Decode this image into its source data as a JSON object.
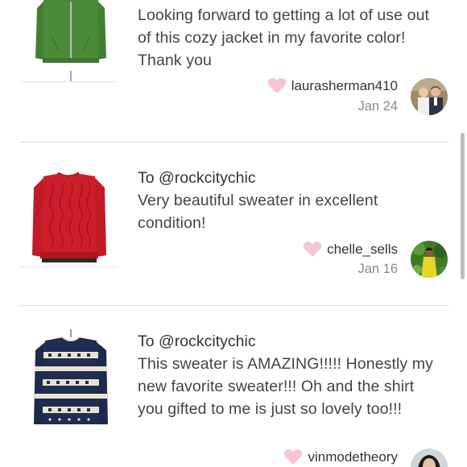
{
  "scrollbar": {
    "color": "#bdbdbd"
  },
  "reviews": [
    {
      "image_icon": "green-zip-jacket",
      "to_line": "",
      "body": "Looking forward to getting a lot of use out of this cozy jacket in my favorite color! Thank you",
      "username": "laurasherman410",
      "date": "Jan 24"
    },
    {
      "image_icon": "red-cable-knit-sweater",
      "to_line": "To @rockcitychic",
      "body": "Very beautiful sweater in excellent condition!",
      "username": "chelle_sells",
      "date": "Jan 16"
    },
    {
      "image_icon": "navy-fair-isle-sweater",
      "to_line": "To @rockcitychic",
      "body": "This sweater is AMAZING!!!!! Honestly my new favorite sweater!!! Oh and the shirt you gifted to me is just so lovely too!!!",
      "username": "vinmodetheory",
      "date": ""
    }
  ],
  "colors": {
    "heart": "#f7c5cf",
    "text": "#333333",
    "date": "#8a8a8a"
  }
}
